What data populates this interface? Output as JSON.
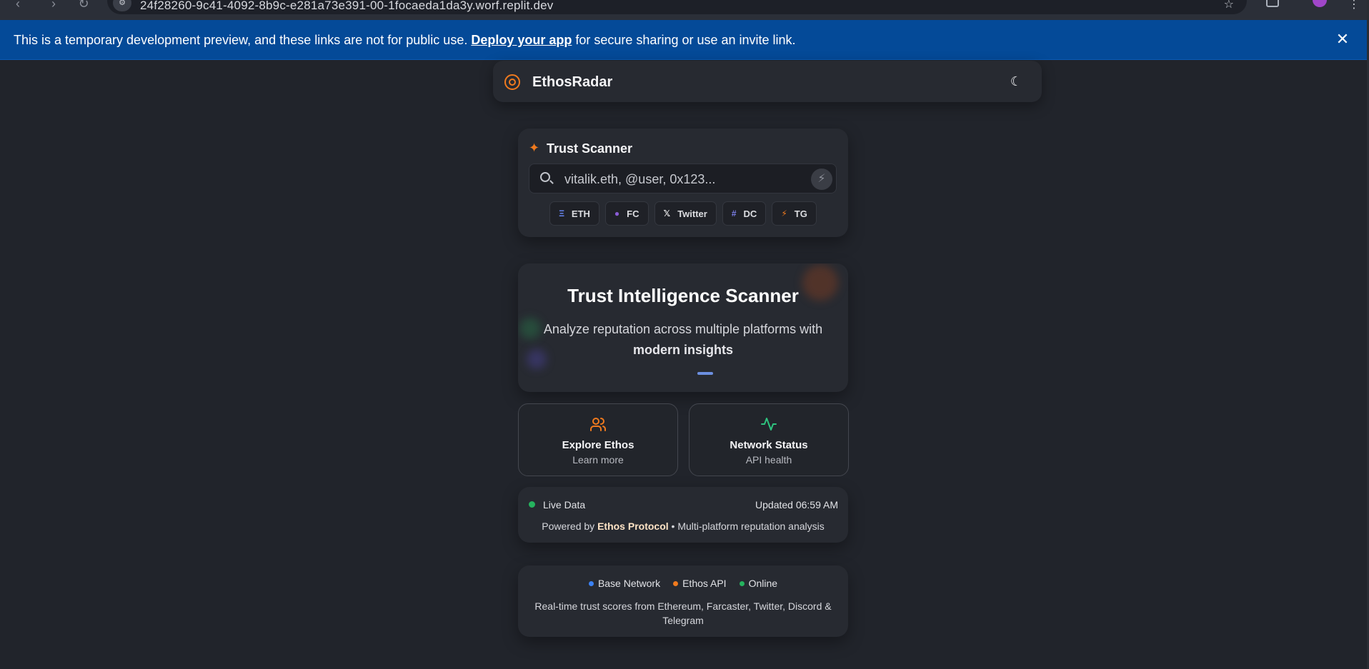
{
  "browser": {
    "url": "24f28260-9c41-4092-8b9c-e281a73e391-00-1focaeda1da3y.worf.replit.dev"
  },
  "banner": {
    "message": "This is a temporary development preview, and these links are not for public use.",
    "link_label": "Deploy your app",
    "message_after": "for secure sharing or use an invite link."
  },
  "header": {
    "brand": "EthosRadar"
  },
  "scanner": {
    "title": "Trust Scanner",
    "placeholder": "vitalik.eth, @user, 0x123...",
    "chips": [
      {
        "label": "ETH",
        "icon": "ethereum-icon",
        "color": "#6b8cff"
      },
      {
        "label": "FC",
        "icon": "farcaster-dot-icon",
        "color": "#8a5cd6"
      },
      {
        "label": "Twitter",
        "icon": "x-icon",
        "color": "#ffffff"
      },
      {
        "label": "DC",
        "icon": "hash-icon",
        "color": "#7b7fe8"
      },
      {
        "label": "TG",
        "icon": "lightning-icon",
        "color": "#f07a1e"
      }
    ]
  },
  "intel": {
    "title": "Trust Intelligence Scanner",
    "subtitle": "Analyze reputation across multiple platforms with",
    "subtitle_bold": "modern insights"
  },
  "actions": [
    {
      "title": "Explore Ethos",
      "subtitle": "Learn more",
      "icon": "users-icon",
      "color": "#f07a1e"
    },
    {
      "title": "Network Status",
      "subtitle": "API health",
      "icon": "activity-icon",
      "color": "#2ec27e"
    }
  ],
  "live": {
    "label": "Live Data",
    "updated": "Updated 06:59 AM",
    "powered_prefix": "Powered by",
    "powered_brand": "Ethos Protocol",
    "powered_suffix": "• Multi-platform reputation analysis"
  },
  "network": {
    "statuses": [
      {
        "label": "Base Network",
        "color": "#3b82f6"
      },
      {
        "label": "Ethos API",
        "color": "#f07a1e"
      },
      {
        "label": "Online",
        "color": "#25b35e"
      }
    ],
    "description": "Real-time trust scores from Ethereum, Farcaster, Twitter, Discord & Telegram"
  },
  "colors": {
    "accent": "#f07a1e",
    "banner": "#044a98",
    "background": "#21242b"
  }
}
